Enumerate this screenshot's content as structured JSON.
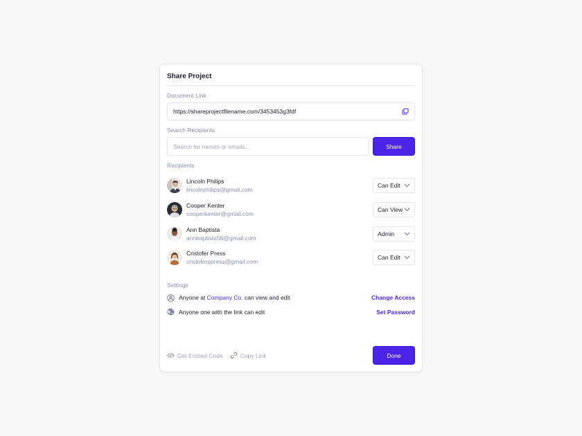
{
  "modal": {
    "title": "Share Project"
  },
  "document_link": {
    "label": "Document Link",
    "value": "https://shareprojectfilename.com/3453453g3fdf",
    "copy_icon": "copy-icon"
  },
  "search": {
    "label": "Search Recipients",
    "placeholder": "Search for names or emails...",
    "button_label": "Share"
  },
  "recipients": {
    "label": "Recipients",
    "items": [
      {
        "name": "Lincoln Philips",
        "email": "lincolnphilips@gmail.com",
        "role": "Can Edit"
      },
      {
        "name": "Cooper Kenter",
        "email": "cooperkenter@gmail.com",
        "role": "Can View"
      },
      {
        "name": "Ann Baptista",
        "email": "annbaptista56@gmail.com",
        "role": "Admin"
      },
      {
        "name": "Cristofer Press",
        "email": "cristoferppress@gmail.com",
        "role": "Can Edit"
      }
    ]
  },
  "settings": {
    "label": "Settings",
    "access": {
      "text_before": "Anyone at ",
      "company": "Company Co.",
      "text_after": " can view and edit",
      "action": "Change Access",
      "icon": "user-circle-icon"
    },
    "link": {
      "text": "Anyone one with the link can edit",
      "action": "Set Password",
      "icon": "globe-icon"
    }
  },
  "footer": {
    "embed_label": "Get Embed Code",
    "copy_label": "Copy Link",
    "done_label": "Done"
  },
  "colors": {
    "accent": "#4b24e8",
    "muted": "#8a8fb0",
    "text": "#1c1d2b",
    "border": "#e3e4ec",
    "background": "#f7f7f7"
  }
}
